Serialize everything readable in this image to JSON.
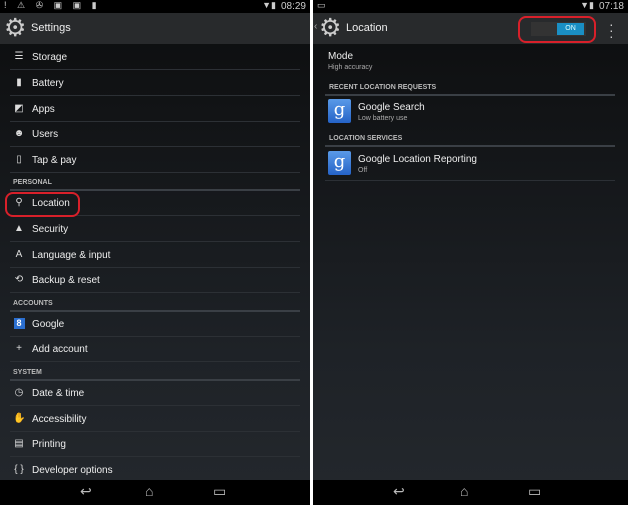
{
  "left": {
    "status": {
      "time": "08:29",
      "icons": "! ⚠ ✇ ▣ ▣ ▮"
    },
    "title": "Settings",
    "items": [
      {
        "label": "Storage",
        "icon": "storage-icon",
        "glyph": "☰"
      },
      {
        "label": "Battery",
        "icon": "battery-icon",
        "glyph": "▮"
      },
      {
        "label": "Apps",
        "icon": "apps-icon",
        "glyph": "◩"
      },
      {
        "label": "Users",
        "icon": "users-icon",
        "glyph": "☻"
      },
      {
        "label": "Tap & pay",
        "icon": "tap-pay-icon",
        "glyph": "▯"
      }
    ],
    "personal": {
      "header": "PERSONAL",
      "items": [
        {
          "label": "Location",
          "icon": "location-pin-icon",
          "glyph": "⚲"
        },
        {
          "label": "Security",
          "icon": "lock-icon",
          "glyph": "▲"
        },
        {
          "label": "Language & input",
          "icon": "language-icon",
          "glyph": "A"
        },
        {
          "label": "Backup & reset",
          "icon": "backup-icon",
          "glyph": "⟲"
        }
      ]
    },
    "accounts": {
      "header": "ACCOUNTS",
      "items": [
        {
          "label": "Google",
          "icon": "google-icon",
          "glyph": "8"
        },
        {
          "label": "Add account",
          "icon": "plus-icon",
          "glyph": "+"
        }
      ]
    },
    "system": {
      "header": "SYSTEM",
      "items": [
        {
          "label": "Date & time",
          "icon": "clock-icon",
          "glyph": "◷"
        },
        {
          "label": "Accessibility",
          "icon": "hand-icon",
          "glyph": "✋"
        },
        {
          "label": "Printing",
          "icon": "printer-icon",
          "glyph": "▤"
        },
        {
          "label": "Developer options",
          "icon": "braces-icon",
          "glyph": "{ }"
        }
      ]
    }
  },
  "right": {
    "status": {
      "time": "07:18"
    },
    "title": "Location",
    "toggle": {
      "label": "ON",
      "state": true,
      "color": "#1a8fc4"
    },
    "mode": {
      "label": "Mode",
      "value": "High accuracy"
    },
    "recent_header": "RECENT LOCATION REQUESTS",
    "recent": [
      {
        "label": "Google Search",
        "sub": "Low battery use"
      }
    ],
    "services_header": "LOCATION SERVICES",
    "services": [
      {
        "label": "Google Location Reporting",
        "sub": "Off"
      }
    ]
  },
  "annotation_color": "#d8202a",
  "nav": {
    "back": "↩",
    "home": "⌂",
    "recents": "▭"
  }
}
